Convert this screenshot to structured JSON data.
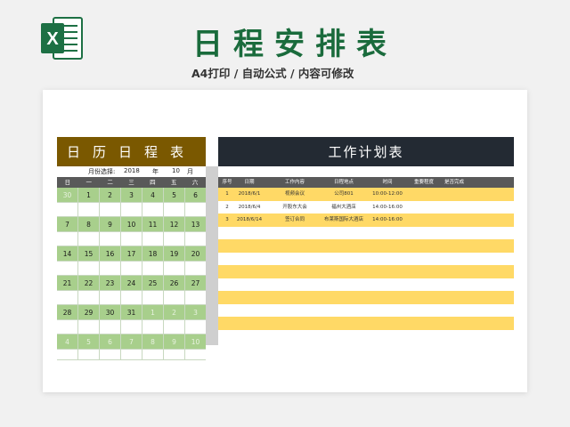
{
  "header": {
    "title": "日程安排表",
    "subtitle": "A4打印 / 自动公式 / 内容可修改",
    "logo_letter": "X",
    "brand_color": "#1a6b3c"
  },
  "calendar": {
    "banner": "日历日程表",
    "month_label": "月份选择:",
    "year": "2018",
    "year_unit": "年",
    "month": "10",
    "month_unit": "月",
    "weekdays": [
      "日",
      "一",
      "二",
      "三",
      "四",
      "五",
      "六"
    ],
    "weeks": [
      [
        "30",
        "1",
        "2",
        "3",
        "4",
        "5",
        "6"
      ],
      [
        "7",
        "8",
        "9",
        "10",
        "11",
        "12",
        "13"
      ],
      [
        "14",
        "15",
        "16",
        "17",
        "18",
        "19",
        "20"
      ],
      [
        "21",
        "22",
        "23",
        "24",
        "25",
        "26",
        "27"
      ],
      [
        "28",
        "29",
        "30",
        "31",
        "1",
        "2",
        "3"
      ],
      [
        "4",
        "5",
        "6",
        "7",
        "8",
        "9",
        "10"
      ]
    ],
    "in_month": [
      [
        false,
        true,
        true,
        true,
        true,
        true,
        true
      ],
      [
        true,
        true,
        true,
        true,
        true,
        true,
        true
      ],
      [
        true,
        true,
        true,
        true,
        true,
        true,
        true
      ],
      [
        true,
        true,
        true,
        true,
        true,
        true,
        true
      ],
      [
        true,
        true,
        true,
        true,
        false,
        false,
        false
      ],
      [
        false,
        false,
        false,
        false,
        false,
        false,
        false
      ]
    ]
  },
  "plan": {
    "banner": "工作计划表",
    "columns": [
      "序号",
      "日期",
      "工作内容",
      "日程地点",
      "时间",
      "重要程度",
      "是否完成"
    ],
    "rows": [
      [
        "1",
        "2018/6/1",
        "视频会议",
        "公司801",
        "10:00-12:00",
        "",
        ""
      ],
      [
        "2",
        "2018/6/4",
        "开股东大会",
        "福州大酒店",
        "14:00-16:00",
        "",
        ""
      ],
      [
        "3",
        "2018/6/14",
        "签订合同",
        "布莱斯国际大酒店",
        "14:00-16:00",
        "",
        ""
      ],
      [
        "",
        "",
        "",
        "",
        "",
        "",
        ""
      ],
      [
        "",
        "",
        "",
        "",
        "",
        "",
        ""
      ],
      [
        "",
        "",
        "",
        "",
        "",
        "",
        ""
      ],
      [
        "",
        "",
        "",
        "",
        "",
        "",
        ""
      ],
      [
        "",
        "",
        "",
        "",
        "",
        "",
        ""
      ],
      [
        "",
        "",
        "",
        "",
        "",
        "",
        ""
      ],
      [
        "",
        "",
        "",
        "",
        "",
        "",
        ""
      ],
      [
        "",
        "",
        "",
        "",
        "",
        "",
        ""
      ],
      [
        "",
        "",
        "",
        "",
        "",
        "",
        ""
      ]
    ]
  }
}
